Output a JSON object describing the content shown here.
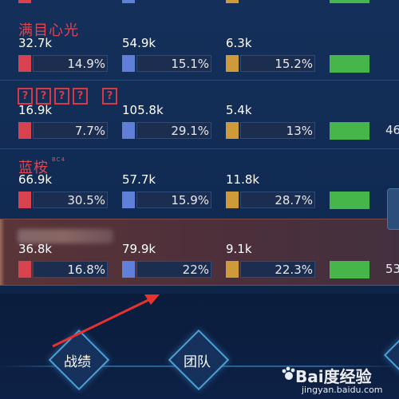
{
  "colors": {
    "kill": "#d8434f",
    "damage": "#5f7fd9",
    "gold": "#cf9a3a",
    "green": "#46b54a"
  },
  "rows": [
    {
      "name": "满目心光",
      "stats": [
        {
          "amount": "32.7k",
          "percent": "14.9%"
        },
        {
          "amount": "54.9k",
          "percent": "15.1%"
        },
        {
          "amount": "6.3k",
          "percent": "15.2%"
        }
      ],
      "extra": ""
    },
    {
      "name_boxes": [
        "?",
        "?",
        "?",
        "?",
        "?"
      ],
      "stats": [
        {
          "amount": "16.9k",
          "percent": "7.7%"
        },
        {
          "amount": "105.8k",
          "percent": "29.1%"
        },
        {
          "amount": "5.4k",
          "percent": "13%"
        }
      ],
      "extra": "46"
    },
    {
      "name": "蓝桉",
      "name_tag": "BC4",
      "stats": [
        {
          "amount": "66.9k",
          "percent": "30.5%"
        },
        {
          "amount": "57.7k",
          "percent": "15.9%"
        },
        {
          "amount": "11.8k",
          "percent": "28.7%"
        }
      ],
      "extra": ""
    },
    {
      "stats": [
        {
          "amount": "36.8k",
          "percent": "16.8%"
        },
        {
          "amount": "79.9k",
          "percent": "22%"
        },
        {
          "amount": "9.1k",
          "percent": "22.3%"
        }
      ],
      "extra": "53"
    }
  ],
  "nav": {
    "record_label": "战绩",
    "team_label": "团队"
  },
  "watermark": {
    "brand": "Bai度经验",
    "url": "jingyan.baidu.com"
  }
}
